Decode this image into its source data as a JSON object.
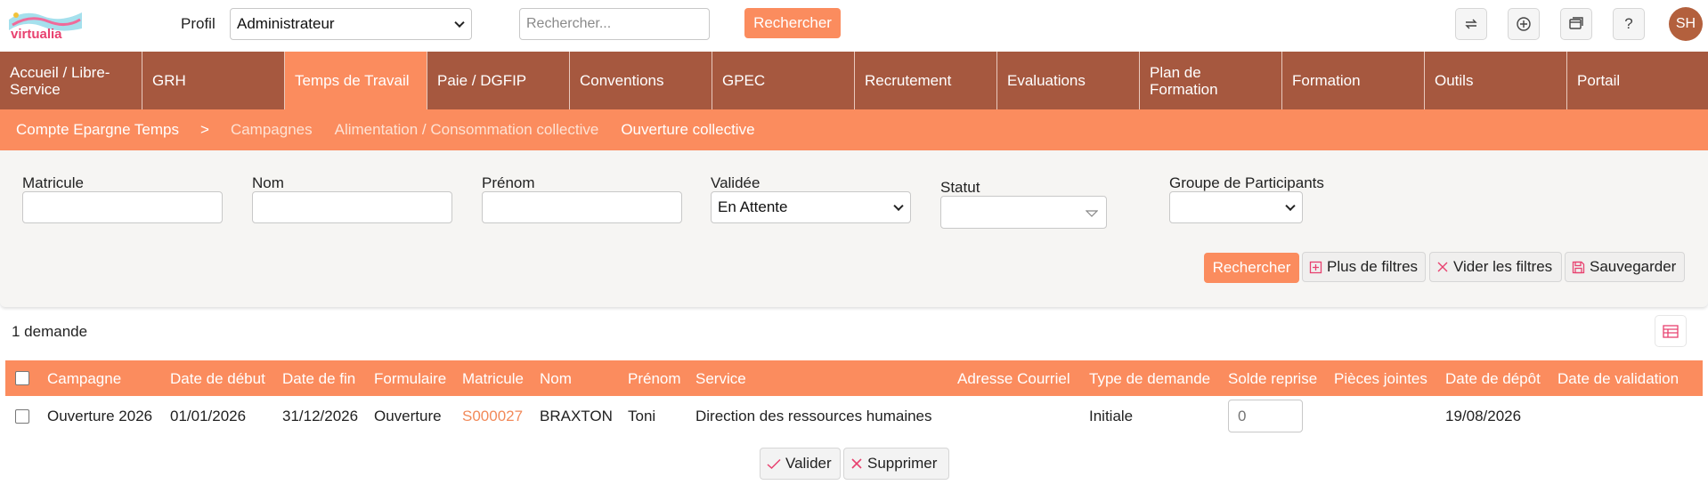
{
  "header": {
    "logo_text": "virtualia",
    "profil_label": "Profil",
    "profil_value": "Administrateur",
    "search_placeholder": "Rechercher...",
    "search_button": "Rechercher",
    "icons": [
      "refresh-icon",
      "plus-circle-icon",
      "windows-icon",
      "help-icon"
    ],
    "help_glyph": "?",
    "avatar_initials": "SH"
  },
  "main_nav": {
    "items": [
      {
        "label": "Accueil / Libre-Service"
      },
      {
        "label": "GRH"
      },
      {
        "label": "Temps de Travail"
      },
      {
        "label": "Paie / DGFIP"
      },
      {
        "label": "Conventions"
      },
      {
        "label": "GPEC"
      },
      {
        "label": "Recrutement"
      },
      {
        "label": "Evaluations"
      },
      {
        "label": "Plan de Formation"
      },
      {
        "label": "Formation"
      },
      {
        "label": "Outils"
      },
      {
        "label": "Portail"
      }
    ],
    "active": "Temps de Travail"
  },
  "sub_nav": {
    "root": "Compte Epargne Temps",
    "separator": ">",
    "items": [
      {
        "label": "Campagnes"
      },
      {
        "label": "Alimentation / Consommation collective"
      },
      {
        "label": "Ouverture collective"
      }
    ],
    "active": "Ouverture collective"
  },
  "filters": {
    "matricule_label": "Matricule",
    "nom_label": "Nom",
    "prenom_label": "Prénom",
    "validee_label": "Validée",
    "validee_value": "En Attente",
    "statut_label": "Statut",
    "groupe_label": "Groupe de Participants",
    "rechercher": "Rechercher",
    "plus_filtres": "Plus de filtres",
    "vider_filtres": "Vider les filtres",
    "sauvegarder": "Sauvegarder"
  },
  "results": {
    "count_text": "1 demande",
    "columns": [
      "Campagne",
      "Date de début",
      "Date de fin",
      "Formulaire",
      "Matricule",
      "Nom",
      "Prénom",
      "Service",
      "Adresse Courriel",
      "Type de demande",
      "Solde reprise",
      "Pièces jointes",
      "Date de dépôt",
      "Date de validation"
    ],
    "rows": [
      {
        "campagne": "Ouverture 2026",
        "date_debut": "01/01/2026",
        "date_fin": "31/12/2026",
        "formulaire": "Ouverture",
        "matricule": "S000027",
        "nom": "BRAXTON",
        "prenom": "Toni",
        "service": "Direction des ressources humaines",
        "adresse_courriel": "",
        "type_demande": "Initiale",
        "solde_reprise_placeholder": "0",
        "pieces_jointes": "",
        "date_depot": "19/08/2026",
        "date_validation": ""
      }
    ],
    "valider": "Valider",
    "supprimer": "Supprimer"
  },
  "colors": {
    "nav_brown": "#a6583f",
    "accent_orange": "#fb8c5e",
    "link_orange": "#f28a5a"
  }
}
